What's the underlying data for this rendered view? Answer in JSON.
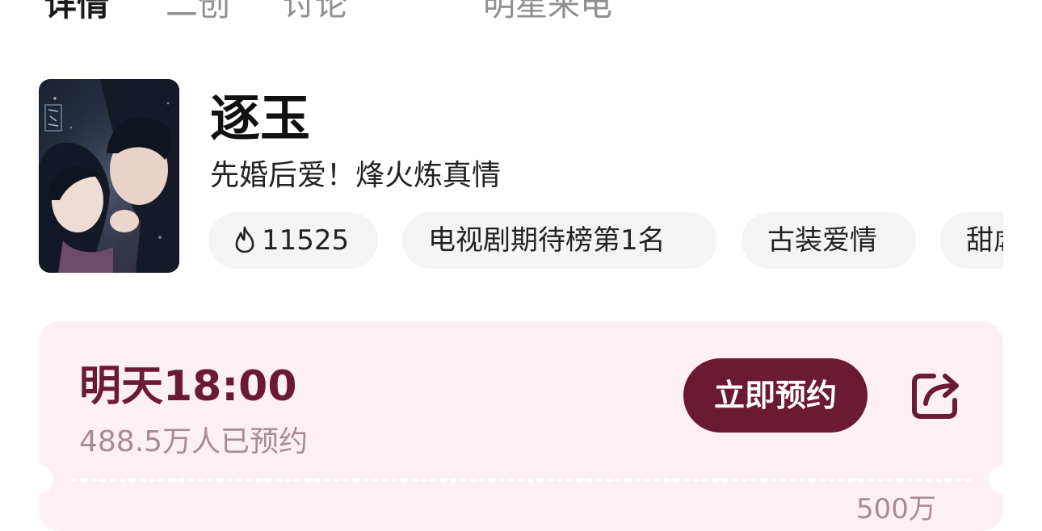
{
  "tabs": [
    {
      "label": "详情",
      "active": true
    },
    {
      "label": "二创",
      "active": false
    },
    {
      "label": "讨论",
      "active": false
    },
    {
      "label": "明星来电",
      "active": false
    }
  ],
  "show": {
    "title": "逐玉",
    "subtitle": "先婚后爱！烽火炼真情",
    "poster_icon": "drama-poster-image"
  },
  "tags": [
    {
      "label": "11525",
      "icon": "fire-icon"
    },
    {
      "label": "电视剧期待榜第1名"
    },
    {
      "label": "古装爱情"
    },
    {
      "label": "甜虐"
    }
  ],
  "reservation": {
    "time": "明天18:00",
    "count_text": "488.5万人已预约",
    "button_label": "立即预约",
    "share_icon": "share-icon",
    "goal_label": "500万"
  },
  "colors": {
    "accent": "#6b1a33",
    "card_bg": "#fdf0f4",
    "tag_bg": "#f4f4f4",
    "muted": "#a88a96"
  }
}
